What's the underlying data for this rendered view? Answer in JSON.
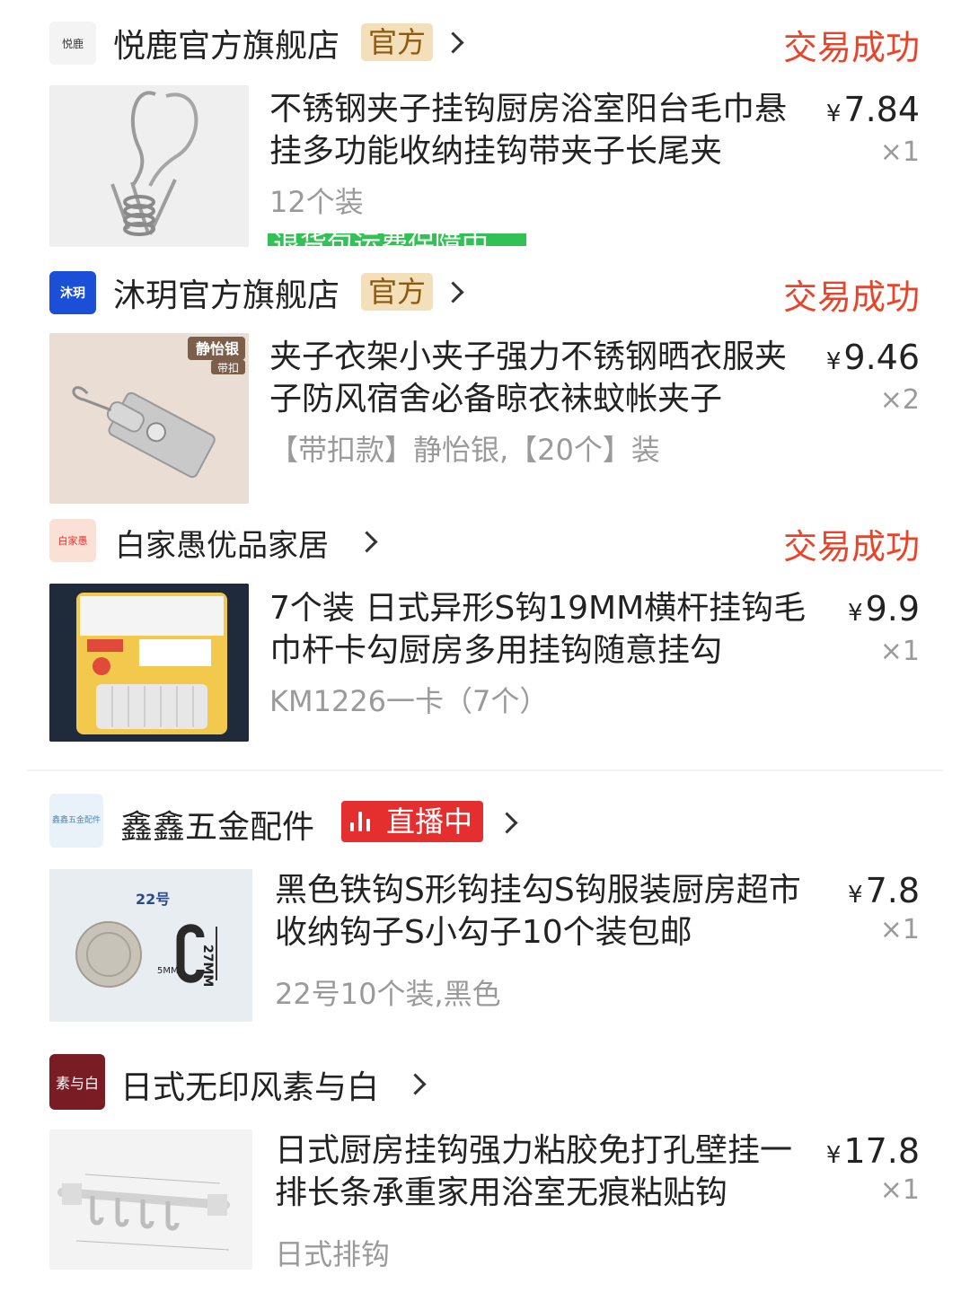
{
  "orders": [
    {
      "shop_name": "悦鹿官方旗舰店",
      "shop_logo_text": "悦鹿",
      "tag": "官方",
      "status": "交易成功",
      "title": "不锈钢夹子挂钩厨房浴室阳台毛巾悬挂多功能收纳挂钩带夹子长尾夹",
      "sku": "12个装",
      "price": "7.84",
      "qty": "×1",
      "guarantee": "退货包运费保障中"
    },
    {
      "shop_name": "沐玥官方旗舰店",
      "shop_logo_text": "沐玥",
      "tag": "官方",
      "status": "交易成功",
      "title": "夹子衣架小夹子强力不锈钢晒衣服夹子防风宿舍必备晾衣袜蚊帐夹子",
      "sku": "【带扣款】静怡银,【20个】装",
      "price": "9.46",
      "qty": "×2",
      "thumb_label_1": "静怡银",
      "thumb_label_2": "带扣"
    },
    {
      "shop_name": "白家愚优品家居",
      "shop_logo_text": "白家愚",
      "status": "交易成功",
      "title": "7个装 日式异形S钩19MM横杆挂钩毛巾杆卡勾厨房多用挂钩随意挂勾",
      "sku": "KM1226一卡（7个）",
      "price": "9.9",
      "qty": "×1"
    },
    {
      "shop_name": "鑫鑫五金配件",
      "shop_logo_text": "鑫鑫五金配件",
      "tag": "直播中",
      "title": "黑色铁钩S形钩挂勾S钩服装厨房超市收纳钩子S小勾子10个装包邮",
      "sku": "22号10个装,黑色",
      "price": "7.8",
      "qty": "×1",
      "thumb_label_1": "22号",
      "thumb_label_2": "27MM",
      "thumb_label_3": "5MM"
    },
    {
      "shop_name": "日式无印风素与白",
      "shop_logo_text": "素与白",
      "title": "日式厨房挂钩强力粘胶免打孔壁挂一排长条承重家用浴室无痕粘贴钩",
      "sku": "日式排钩",
      "price": "17.8",
      "qty": "×1"
    }
  ],
  "currency_symbol": "¥",
  "colors": {
    "status": "#e8442a",
    "official_tag_bg": "#f3dfb9",
    "live_tag_bg": "#e52f2f",
    "guarantee": "#31c154"
  }
}
